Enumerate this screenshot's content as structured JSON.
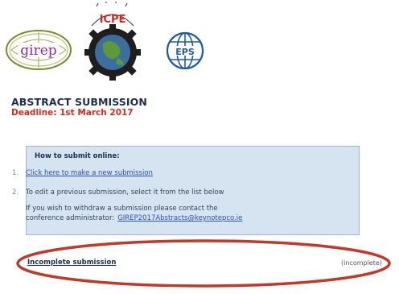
{
  "logos": {
    "girep": "girep",
    "icpe": "ICPE",
    "eps": "EPS"
  },
  "heading": "ABSTRACT SUBMISSION",
  "deadline": "Deadline: 1st March 2017",
  "howto": {
    "title": "How to submit online:",
    "steps": [
      {
        "num": "1.",
        "text": "Click here to make a new submission"
      },
      {
        "num": "2.",
        "text": "To edit a previous submission, select it from the list below"
      }
    ],
    "withdraw_line1": "If you wish to withdraw a submission please contact the",
    "withdraw_line2": "conference administrator:",
    "withdraw_email": "GIREP2017Abstracts@keynotepco.ie"
  },
  "submissions": [
    {
      "title": "Incomplete submission",
      "status": "(incomplete)"
    }
  ],
  "colors": {
    "heading": "#1c2e4a",
    "deadline": "#e0281a",
    "box_bg": "#d6e4f2",
    "link": "#2653b8",
    "highlight": "#c0392b"
  }
}
